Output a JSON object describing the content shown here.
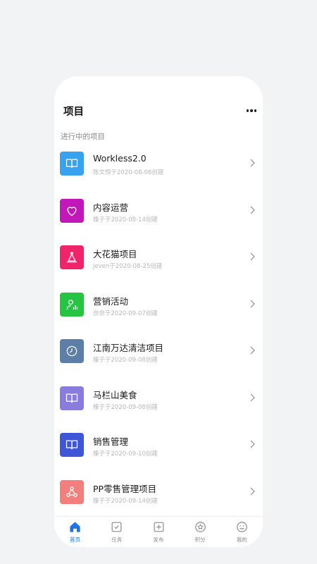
{
  "header": {
    "title": "项目"
  },
  "section_label": "进行中的项目",
  "projects": [
    {
      "name": "Workless2.0",
      "meta": "陈文悦于2020-08-06创建",
      "color": "#39a2ee",
      "icon": "book-icon"
    },
    {
      "name": "内容运营",
      "meta": "橡子于2020-08-14创建",
      "color": "#c218b9",
      "icon": "heart-icon"
    },
    {
      "name": "大花猫项目",
      "meta": "Jeven于2020-08-25创建",
      "color": "#f0246b",
      "icon": "flask-icon"
    },
    {
      "name": "营销活动",
      "meta": "奈奈于2020-09-07创建",
      "color": "#27c443",
      "icon": "user-chart-icon"
    },
    {
      "name": "江南万达清洁项目",
      "meta": "橡子于2020-09-08创建",
      "color": "#5d7ea6",
      "icon": "clock-icon"
    },
    {
      "name": "马栏山美食",
      "meta": "橡子于2020-09-08创建",
      "color": "#8a7cde",
      "icon": "book-icon"
    },
    {
      "name": "销售管理",
      "meta": "橡子于2020-09-10创建",
      "color": "#3f56d6",
      "icon": "book-icon"
    },
    {
      "name": "PP零售管理项目",
      "meta": "橡子于2020-09-14创建",
      "color": "#f37e7e",
      "icon": "network-icon"
    }
  ],
  "tabs": [
    {
      "label": "首页",
      "icon": "home-icon",
      "active": true
    },
    {
      "label": "任务",
      "icon": "task-icon",
      "active": false
    },
    {
      "label": "发布",
      "icon": "add-icon",
      "active": false
    },
    {
      "label": "积分",
      "icon": "points-icon",
      "active": false
    },
    {
      "label": "我的",
      "icon": "smile-icon",
      "active": false
    }
  ],
  "colors": {
    "accent": "#1f73e0",
    "tab_inactive": "#8a8a8a"
  }
}
